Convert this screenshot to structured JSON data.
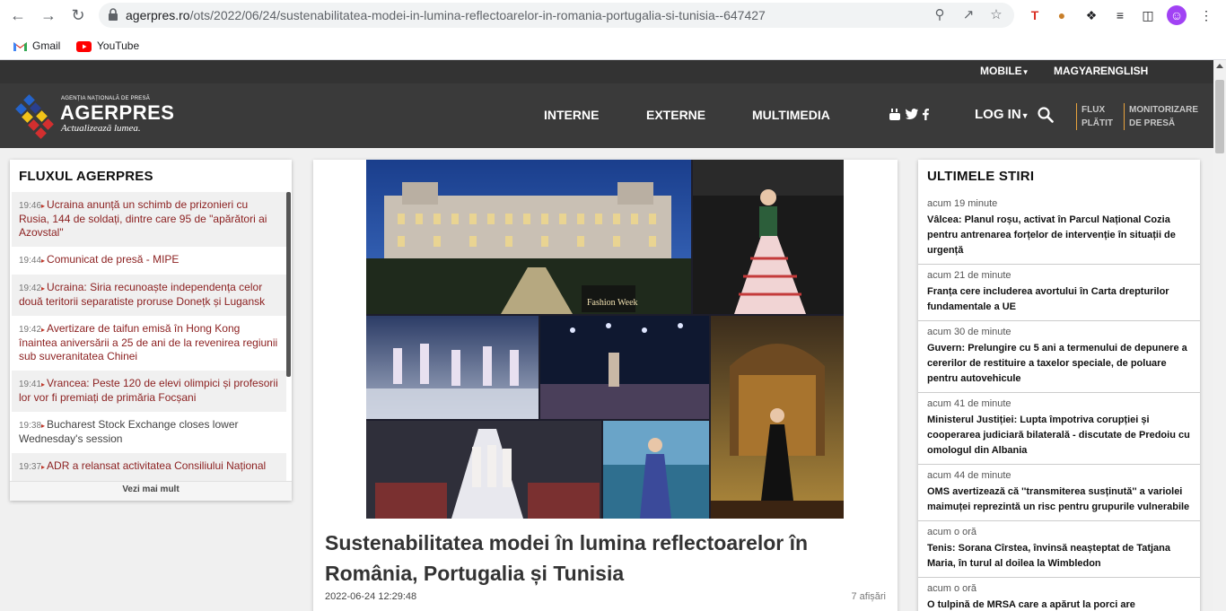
{
  "browser": {
    "url_host": "agerpres.ro",
    "url_path": "/ots/2022/06/24/sustenabilitatea-modei-in-lumina-reflectoarelor-in-romania-portugalia-si-tunisia--647427",
    "bookmarks": [
      {
        "label": "Gmail",
        "icon": "gmail-icon"
      },
      {
        "label": "YouTube",
        "icon": "youtube-icon"
      }
    ]
  },
  "site": {
    "top_links": [
      "MOBILE",
      "MAGYAR",
      "ENGLISH"
    ],
    "logo": {
      "small_text": "AGENȚIA NAȚIONALĂ DE PRESĂ",
      "name": "AGERPRES",
      "slogan": "Actualizează lumea."
    },
    "nav": [
      "INTERNE",
      "EXTERNE",
      "MULTIMEDIA"
    ],
    "social": [
      "youtube-icon",
      "twitter-icon",
      "facebook-icon"
    ],
    "login": "LOG IN",
    "side_links": [
      {
        "line1": "FLUX",
        "line2": "PLĂTIT"
      },
      {
        "line1": "MONITORIZARE",
        "line2": "DE PRESĂ"
      }
    ],
    "colors": {
      "header": "#3a3a3a",
      "accent": "#e8a33d",
      "feed_link": "#8b1f1f"
    }
  },
  "left_panel": {
    "title": "FLUXUL AGERPRES",
    "items": [
      {
        "time": "19:46",
        "text": "Ucraina anunță un schimb de prizonieri cu Rusia, 144 de soldați, dintre care 95 de \"apărători ai Azovstal\""
      },
      {
        "time": "19:44",
        "text": "Comunicat de presă - MIPE"
      },
      {
        "time": "19:42",
        "text": "Ucraina: Siria recunoaște independența celor două teritorii separatiste proruse Donețk și Lugansk"
      },
      {
        "time": "19:42",
        "text": "Avertizare de taifun emisă în Hong Kong înaintea aniversării a 25 de ani de la revenirea regiunii sub suveranitatea Chinei"
      },
      {
        "time": "19:41",
        "text": "Vrancea: Peste 120 de elevi olimpici și profesorii lor vor fi premiați de primăria Focșani"
      },
      {
        "time": "19:38",
        "text": "Bucharest Stock Exchange closes lower Wednesday's session"
      },
      {
        "time": "19:37",
        "text": "ADR a relansat activitatea Consiliului Național"
      }
    ],
    "see_more": "Vezi mai mult"
  },
  "article": {
    "title": "Sustenabilitatea modei în lumina reflectoarelor în România, Portugalia și Tunisia",
    "date": "2022-06-24 12:29:48",
    "views": "7 afișări",
    "image_caption": "Fashion Week"
  },
  "right_panel": {
    "title": "ULTIMELE STIRI",
    "items": [
      {
        "ago": "acum 19 minute",
        "headline": "Vâlcea: Planul roșu, activat în Parcul Național Cozia pentru antrenarea forțelor de intervenție în situații de urgență"
      },
      {
        "ago": "acum 21 de minute",
        "headline": "Franța cere includerea avortului în Carta drepturilor fundamentale a UE"
      },
      {
        "ago": "acum 30 de minute",
        "headline": "Guvern: Prelungire cu 5 ani a termenului de depunere a cererilor de restituire a taxelor speciale, de poluare pentru autovehicule"
      },
      {
        "ago": "acum 41 de minute",
        "headline": "Ministerul Justiției: Lupta împotriva corupției și cooperarea judiciară bilaterală - discutate de Predoiu cu omologul din Albania"
      },
      {
        "ago": "acum 44 de minute",
        "headline": "OMS avertizează că ''transmiterea susținută'' a variolei maimuței reprezintă un risc pentru grupurile vulnerabile"
      },
      {
        "ago": "acum o oră",
        "headline": "Tenis: Sorana Cîrstea, învinsă neașteptat de Tatjana Maria, în turul al doilea la Wimbledon"
      },
      {
        "ago": "acum o oră",
        "headline": "O tulpină de MRSA care a apărut la porci are ''capacitatea de a se transmite ușor la oameni''"
      }
    ]
  }
}
